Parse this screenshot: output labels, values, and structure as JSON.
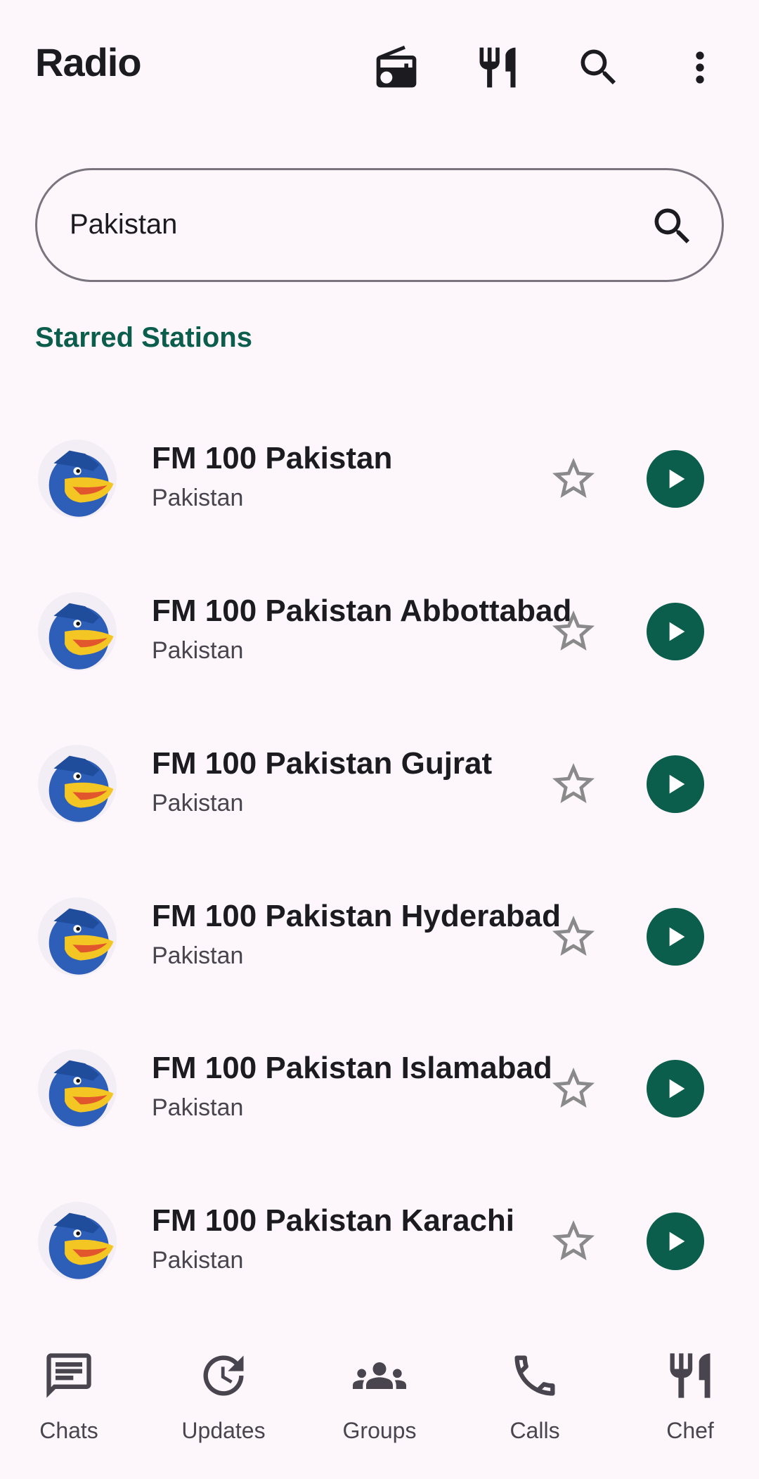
{
  "app_bar": {
    "title": "Radio",
    "icons": [
      "radio-icon",
      "restaurant-icon",
      "search-icon",
      "more-vert-icon"
    ]
  },
  "search": {
    "value": "Pakistan",
    "icon": "search-icon"
  },
  "section": {
    "title": "Starred Stations"
  },
  "stations": [
    {
      "name": "FM 100 Pakistan",
      "country": "Pakistan"
    },
    {
      "name": "FM 100 Pakistan Abbottabad",
      "country": "Pakistan"
    },
    {
      "name": "FM 100 Pakistan Gujrat",
      "country": "Pakistan"
    },
    {
      "name": "FM 100 Pakistan Hyderabad",
      "country": "Pakistan"
    },
    {
      "name": "FM 100 Pakistan Islamabad",
      "country": "Pakistan"
    },
    {
      "name": "FM 100 Pakistan Karachi",
      "country": "Pakistan"
    }
  ],
  "bottom_nav": [
    {
      "label": "Chats",
      "icon": "chat-icon"
    },
    {
      "label": "Updates",
      "icon": "updates-icon"
    },
    {
      "label": "Groups",
      "icon": "groups-icon"
    },
    {
      "label": "Calls",
      "icon": "phone-icon"
    },
    {
      "label": "Chef",
      "icon": "restaurant-icon"
    }
  ],
  "colors": {
    "accent": "#0b5d4c",
    "background": "#fdf7fc",
    "outline": "#79747e",
    "star": "#8a8a8a"
  }
}
